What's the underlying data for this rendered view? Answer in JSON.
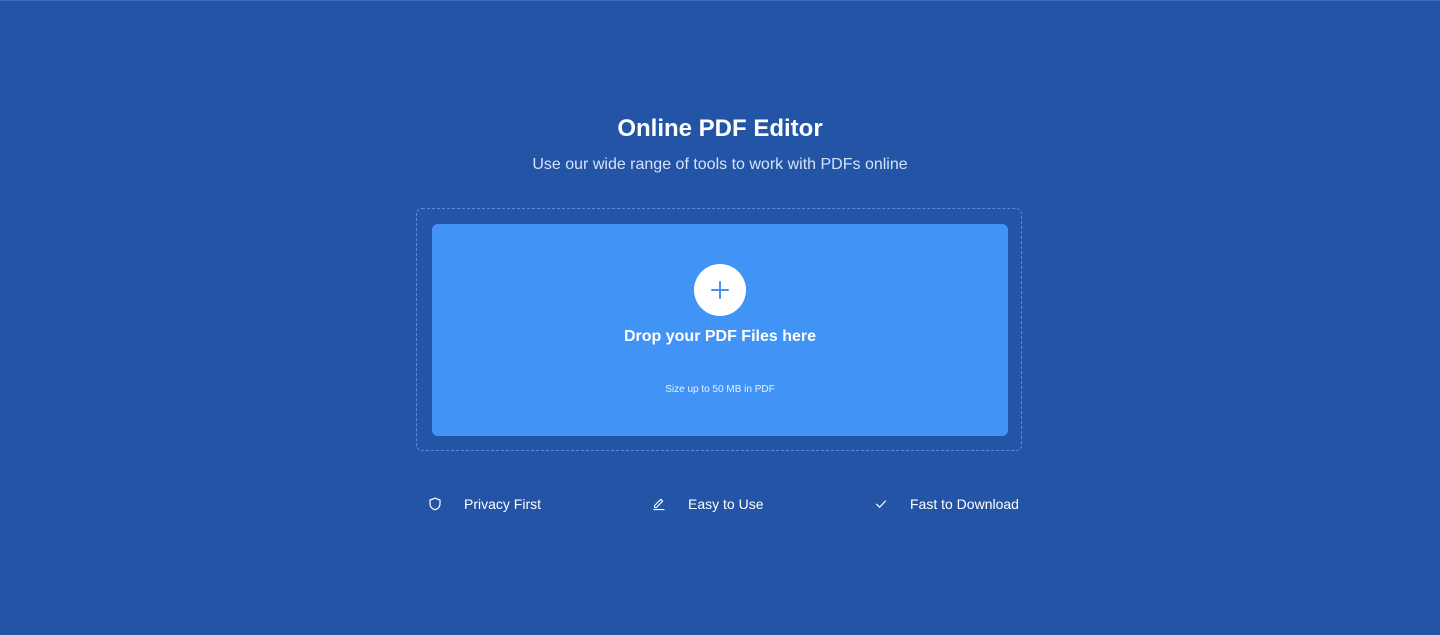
{
  "header": {
    "title": "Online PDF Editor",
    "subtitle": "Use our wide range of tools to work with PDFs online"
  },
  "upload": {
    "add_icon": "plus-icon",
    "drop_label": "Drop your PDF Files here",
    "size_note": "Size up to 50 MB in PDF"
  },
  "features": [
    {
      "icon": "shield-icon",
      "label": "Privacy First"
    },
    {
      "icon": "pencil-icon",
      "label": "Easy to Use"
    },
    {
      "icon": "check-icon",
      "label": "Fast to Download"
    }
  ],
  "colors": {
    "background": "#2354a5",
    "dropzone": "#4193f6",
    "accent": "#4193f6",
    "text": "#ffffff"
  }
}
